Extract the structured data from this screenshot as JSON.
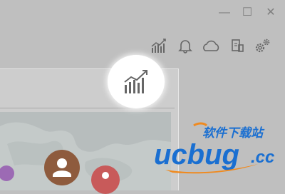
{
  "window": {
    "minimize_label": "—",
    "maximize_label": "☐",
    "close_label": "✕"
  },
  "toolbar": {
    "icons": [
      {
        "name": "stats-icon",
        "glyph": "chart"
      },
      {
        "name": "bell-icon",
        "glyph": "bell"
      },
      {
        "name": "cloud-icon",
        "glyph": "cloud"
      },
      {
        "name": "files-icon",
        "glyph": "files"
      },
      {
        "name": "settings-icon",
        "glyph": "gear"
      }
    ]
  },
  "watermark": {
    "chinese_text": "软件下载站",
    "logo_text": "ucbug",
    "domain_text": ".cc",
    "colors": {
      "primary_blue": "#1a6fd1",
      "accent_orange": "#f08a1f"
    }
  },
  "colors": {
    "background": "#bfbfbf",
    "avatar_purple": "#9c6ab4",
    "avatar_brown": "#8e5b3d",
    "avatar_red": "#c85a5a"
  }
}
